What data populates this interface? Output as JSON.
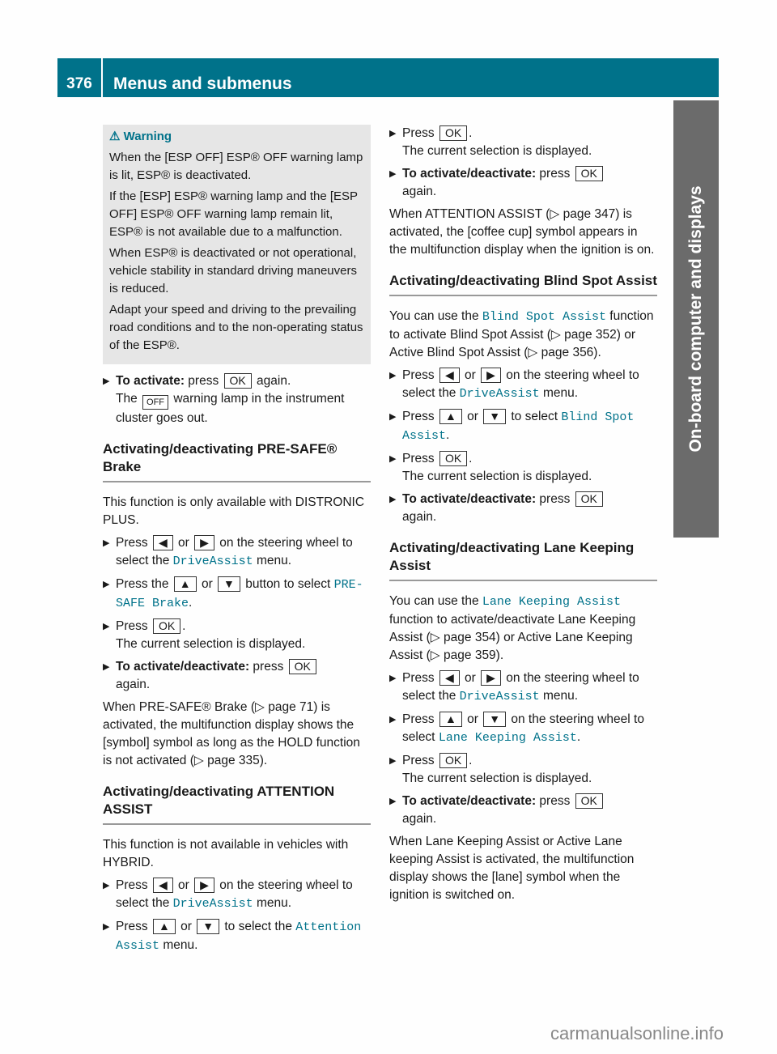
{
  "header": {
    "page_number": "376",
    "title": "Menus and submenus"
  },
  "side_tab": "On-board computer and displays",
  "warning": {
    "title": "Warning",
    "paragraphs": [
      "When the [ESP OFF] ESP® OFF warning lamp is lit, ESP® is deactivated.",
      "If the [ESP] ESP® warning lamp and the [ESP OFF] ESP® OFF warning lamp remain lit, ESP® is not available due to a malfunction.",
      "When ESP® is deactivated or not operational, vehicle stability in standard driving maneuvers is reduced.",
      "Adapt your speed and driving to the prevailing road conditions and to the non-operating status of the ESP®."
    ]
  },
  "col1": {
    "activate_step": {
      "bold": "To activate:",
      "text1": " press ",
      "key": "OK",
      "text2": " again.",
      "sub1": "The ",
      "sub2": " warning lamp in the instrument cluster goes out."
    },
    "presafe": {
      "heading": "Activating/deactivating PRE-SAFE® Brake",
      "intro": "This function is only available with DISTRONIC PLUS.",
      "s1a": "Press ",
      "s1b": " or ",
      "s1c": " on the steering wheel to select the ",
      "menu": "DriveAssist",
      "s1d": " menu.",
      "s2a": "Press the ",
      "s2b": " or ",
      "s2c": " button to select ",
      "item": "PRE-SAFE Brake",
      "s2d": ".",
      "s3a": "Press ",
      "s3b": ".",
      "s3sub": "The current selection is displayed.",
      "s4bold": "To activate/deactivate:",
      "s4a": " press ",
      "s4b": " again.",
      "note": "When PRE-SAFE® Brake (▷ page 71) is activated, the multifunction display shows the [symbol] symbol as long as the HOLD function is not activated (▷ page 335)."
    },
    "attention": {
      "heading": "Activating/deactivating ATTENTION ASSIST",
      "intro": "This function is not available in vehicles with HYBRID.",
      "s1a": "Press ",
      "s1b": " or ",
      "s1c": " on the steering wheel to select the ",
      "menu": "DriveAssist",
      "s1d": " menu.",
      "s2a": "Press ",
      "s2b": " or ",
      "s2c": " to select the ",
      "item": "Attention Assist",
      "s2d": " menu."
    }
  },
  "col2": {
    "att_cont": {
      "s3a": "Press ",
      "s3b": ".",
      "s3sub": "The current selection is displayed.",
      "s4bold": "To activate/deactivate:",
      "s4a": " press ",
      "s4b": " again.",
      "note": "When ATTENTION ASSIST (▷ page 347) is activated, the [coffee cup] symbol appears in the multifunction display when the ignition is on."
    },
    "blind": {
      "heading": "Activating/deactivating Blind Spot Assist",
      "intro_a": "You can use the ",
      "intro_item": "Blind Spot Assist",
      "intro_b": " function to activate Blind Spot Assist (▷ page 352) or Active Blind Spot Assist (▷ page 356).",
      "s1a": "Press ",
      "s1b": " or ",
      "s1c": " on the steering wheel to select the ",
      "menu": "DriveAssist",
      "s1d": " menu.",
      "s2a": "Press ",
      "s2b": " or ",
      "s2c": " to select ",
      "item": "Blind Spot Assist",
      "s2d": ".",
      "s3a": "Press ",
      "s3b": ".",
      "s3sub": "The current selection is displayed.",
      "s4bold": "To activate/deactivate:",
      "s4a": " press ",
      "s4b": " again."
    },
    "lane": {
      "heading": "Activating/deactivating Lane Keeping Assist",
      "intro_a": "You can use the ",
      "intro_item": "Lane Keeping Assist",
      "intro_b": " function to activate/deactivate Lane Keeping Assist (▷ page 354) or Active Lane Keeping Assist (▷ page 359).",
      "s1a": "Press ",
      "s1b": " or ",
      "s1c": " on the steering wheel to select the ",
      "menu": "DriveAssist",
      "s1d": " menu.",
      "s2a": "Press ",
      "s2b": " or ",
      "s2c": " on the steering wheel to select ",
      "item": "Lane Keeping Assist",
      "s2d": ".",
      "s3a": "Press ",
      "s3b": ".",
      "s3sub": "The current selection is displayed.",
      "s4bold": "To activate/deactivate:",
      "s4a": " press ",
      "s4b": " again.",
      "note": "When Lane Keeping Assist or Active Lane keeping Assist is activated, the multifunction display shows the [lane] symbol when the ignition is switched on."
    }
  },
  "keys": {
    "ok": "OK",
    "left": "◀",
    "right": "▶",
    "up": "▲",
    "down": "▼"
  },
  "watermark": "carmanualsonline.info"
}
